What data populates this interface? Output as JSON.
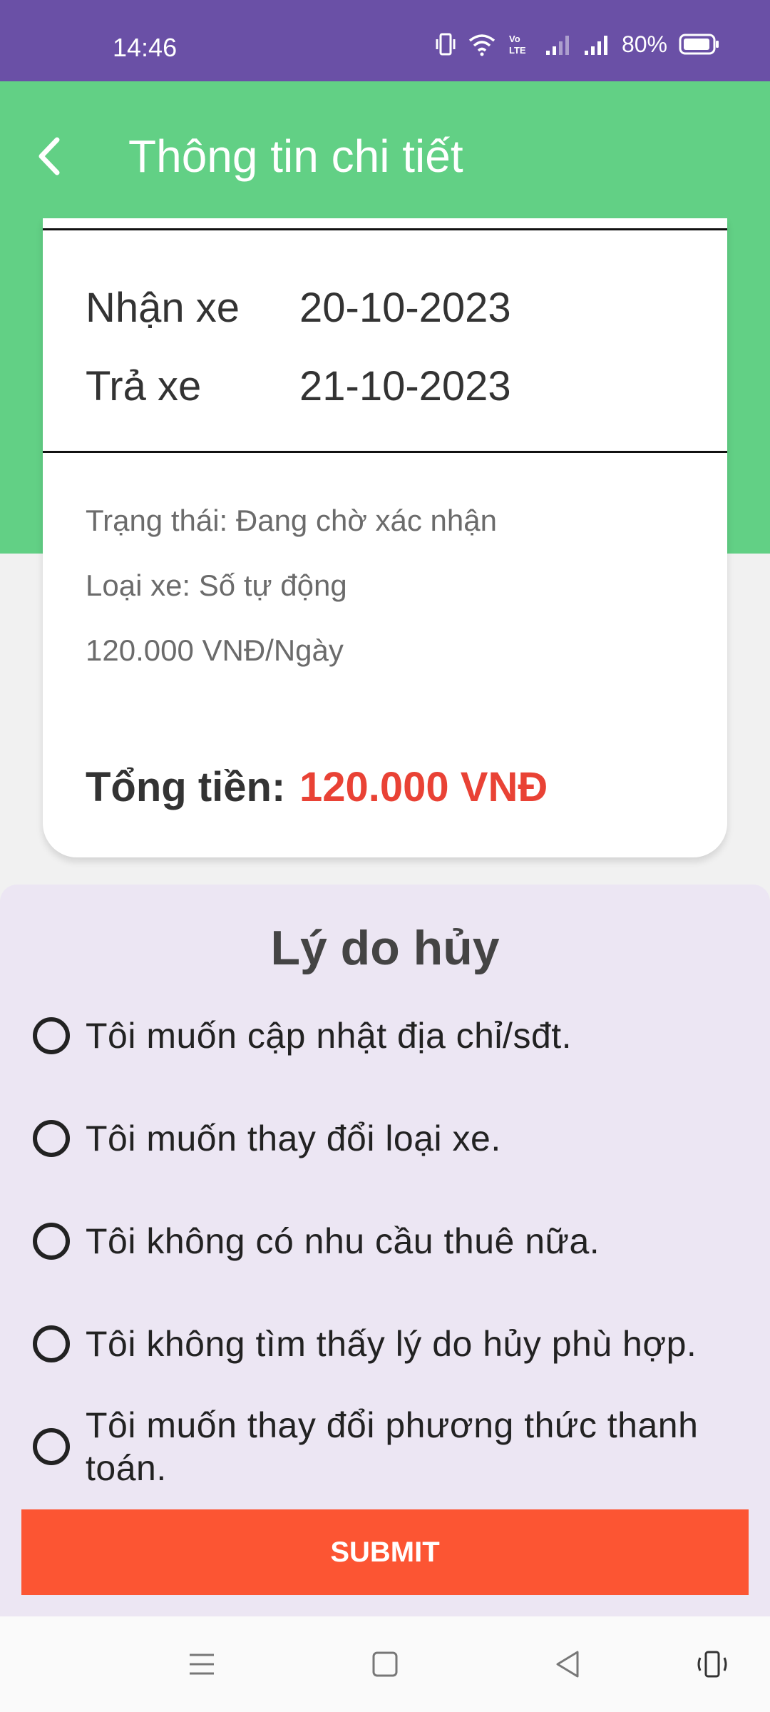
{
  "status_bar": {
    "time": "14:46",
    "battery": "80%",
    "icons": [
      "vibrate-icon",
      "wifi-icon",
      "volte-icon",
      "signal-icon",
      "signal-icon",
      "battery-icon"
    ]
  },
  "header": {
    "title": "Thông tin chi tiết",
    "back_icon": "chevron-left-icon",
    "background_color": "#62d085"
  },
  "booking": {
    "pickup_label": "Nhận xe",
    "pickup_date": "20-10-2023",
    "return_label": "Trả xe",
    "return_date": "21-10-2023",
    "status": "Trạng thái: Đang chờ xác nhận",
    "car_type": "Loại xe: Số tự động",
    "price": "120.000 VNĐ/Ngày",
    "total_label": "Tổng tiền:",
    "total_value": "120.000 VNĐ",
    "total_color": "#e94235"
  },
  "cancel": {
    "heading": "Lý do hủy",
    "options": [
      {
        "label": "Tôi muốn cập nhật địa chỉ/sđt.",
        "selected": false
      },
      {
        "label": "Tôi muốn thay đổi loại xe.",
        "selected": false
      },
      {
        "label": "Tôi không có nhu cầu thuê nữa.",
        "selected": false
      },
      {
        "label": "Tôi không tìm thấy lý do hủy phù hợp.",
        "selected": false
      },
      {
        "label": "Tôi muốn thay đổi phương thức thanh toán.",
        "selected": false
      }
    ],
    "submit_label": "SUBMIT",
    "submit_color": "#fc5533"
  },
  "nav_bar": {
    "buttons": [
      "menu-icon",
      "home-icon",
      "back-icon",
      "rotate-icon"
    ]
  }
}
